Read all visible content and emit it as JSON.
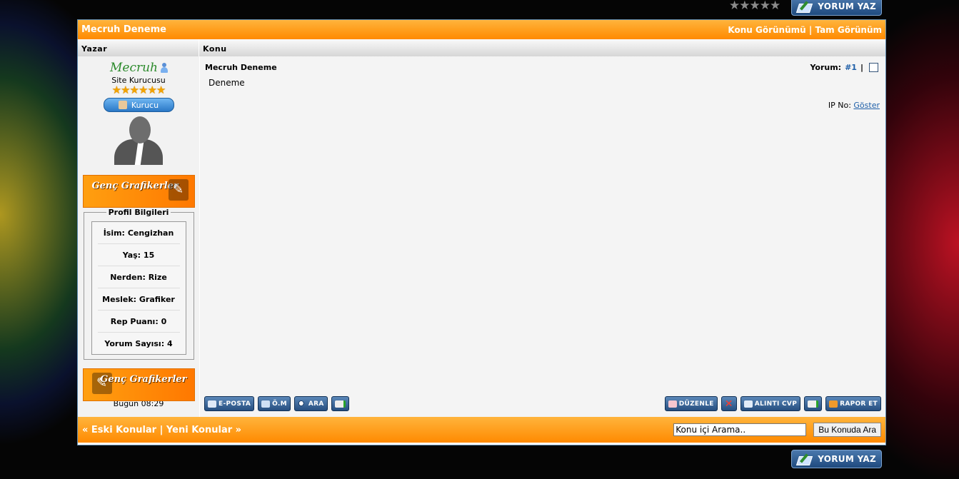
{
  "topbar": {
    "rating_stars": "★★★★★",
    "reply_button": "YORUM YAZ"
  },
  "thread": {
    "title": "Mecruh Deneme",
    "view_threaded": "Konu Görünümü",
    "separator": "|",
    "view_full": "Tam Görünüm"
  },
  "columns": {
    "author": "Yazar",
    "topic": "Konu"
  },
  "author": {
    "username": "Mecruh",
    "rank_title": "Site Kurucusu",
    "rank_stars": "★★★★★★",
    "rank_badge": "Kurucu",
    "banner_text": "Genç Grafikerler",
    "profile_legend": "Profil Bilgileri",
    "profile": [
      {
        "label": "İsim:",
        "value": "Cengizhan"
      },
      {
        "label": "Yaş:",
        "value": "15"
      },
      {
        "label": "Nerden:",
        "value": "Rize"
      },
      {
        "label": "Meslek:",
        "value": "Grafiker"
      },
      {
        "label": "Rep Puanı:",
        "value": "0"
      },
      {
        "label": "Yorum Sayısı:",
        "value": "4"
      }
    ]
  },
  "post": {
    "title": "Mecruh Deneme",
    "number_label": "Yorum:",
    "number": "#1",
    "separator": "|",
    "content": "Deneme",
    "ip_label": "IP No:",
    "ip_link": "Göster",
    "date": "Bugün 08:29"
  },
  "actions_left": [
    "E-POSTA",
    "Ö.M",
    "ARA",
    ""
  ],
  "actions_right": [
    "DÜZENLE",
    "",
    "ALINTI CVP",
    "",
    "RAPOR ET"
  ],
  "bottom": {
    "prev": "« Eski Konular",
    "separator": "|",
    "next": "Yeni Konular »",
    "search_value": "Konu içi Arama..",
    "search_button": "Bu Konuda Ara"
  }
}
